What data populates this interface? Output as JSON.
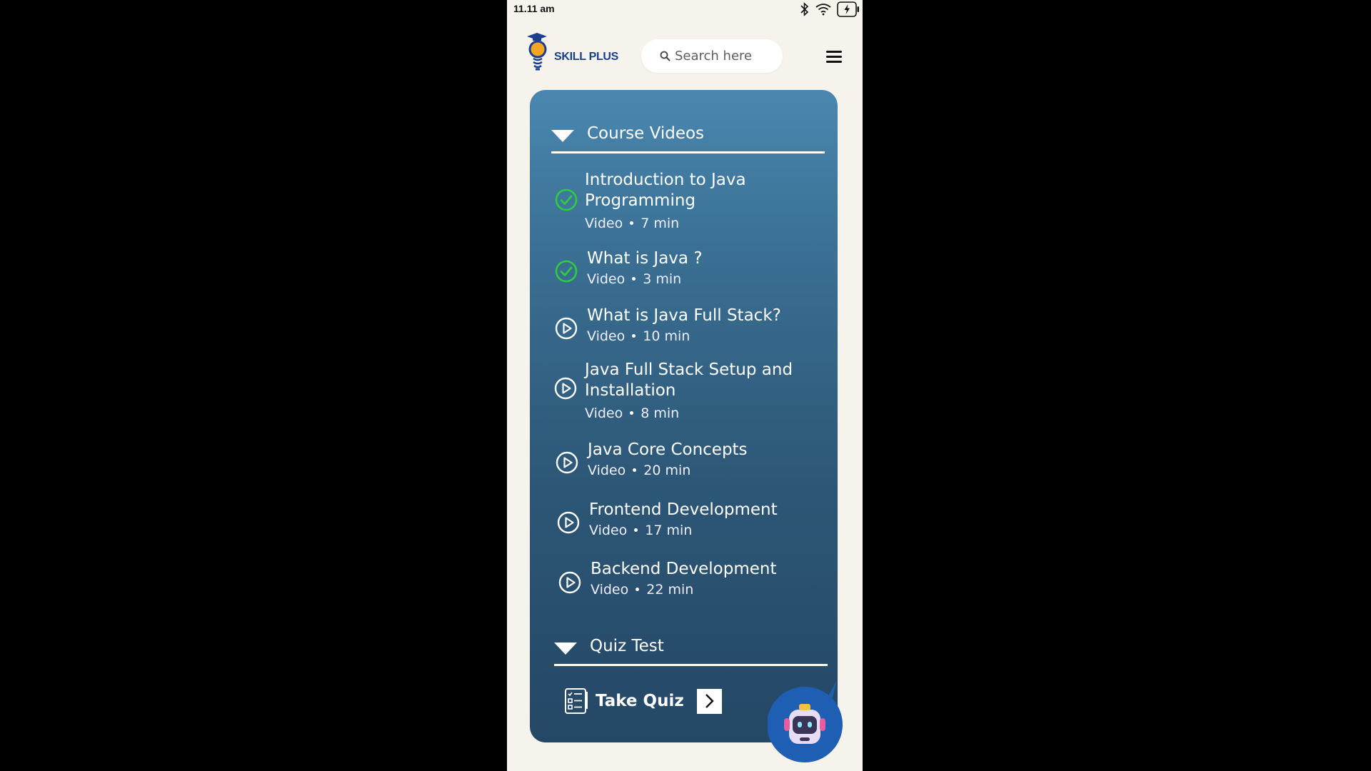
{
  "status_bar": {
    "time": "11.11 am"
  },
  "header": {
    "brand": "SKILL PLUS",
    "search": {
      "placeholder": "Search here",
      "value": ""
    }
  },
  "sections": {
    "course_videos": {
      "title": "Course Videos",
      "items": [
        {
          "title": "Introduction to Java Programming",
          "type": "Video",
          "duration": "7 min",
          "status": "completed"
        },
        {
          "title": "What is Java ?",
          "type": "Video",
          "duration": "3 min",
          "status": "completed"
        },
        {
          "title": "What is Java Full Stack?",
          "type": "Video",
          "duration": "10 min",
          "status": "play"
        },
        {
          "title": "Java Full Stack Setup and Installation",
          "type": "Video",
          "duration": "8 min",
          "status": "play"
        },
        {
          "title": "Java Core Concepts",
          "type": "Video",
          "duration": "20 min",
          "status": "play"
        },
        {
          "title": "Frontend Development",
          "type": "Video",
          "duration": "17 min",
          "status": "play"
        },
        {
          "title": "Backend Development",
          "type": "Video",
          "duration": "22 min",
          "status": "play"
        }
      ]
    },
    "quiz": {
      "title": "Quiz Test",
      "take_quiz_label": "Take Quiz"
    }
  },
  "colors": {
    "completed": "#2ecc40",
    "panel_top": "#4a87b0",
    "panel_bottom": "#244765",
    "brand": "#1a3f8f"
  }
}
